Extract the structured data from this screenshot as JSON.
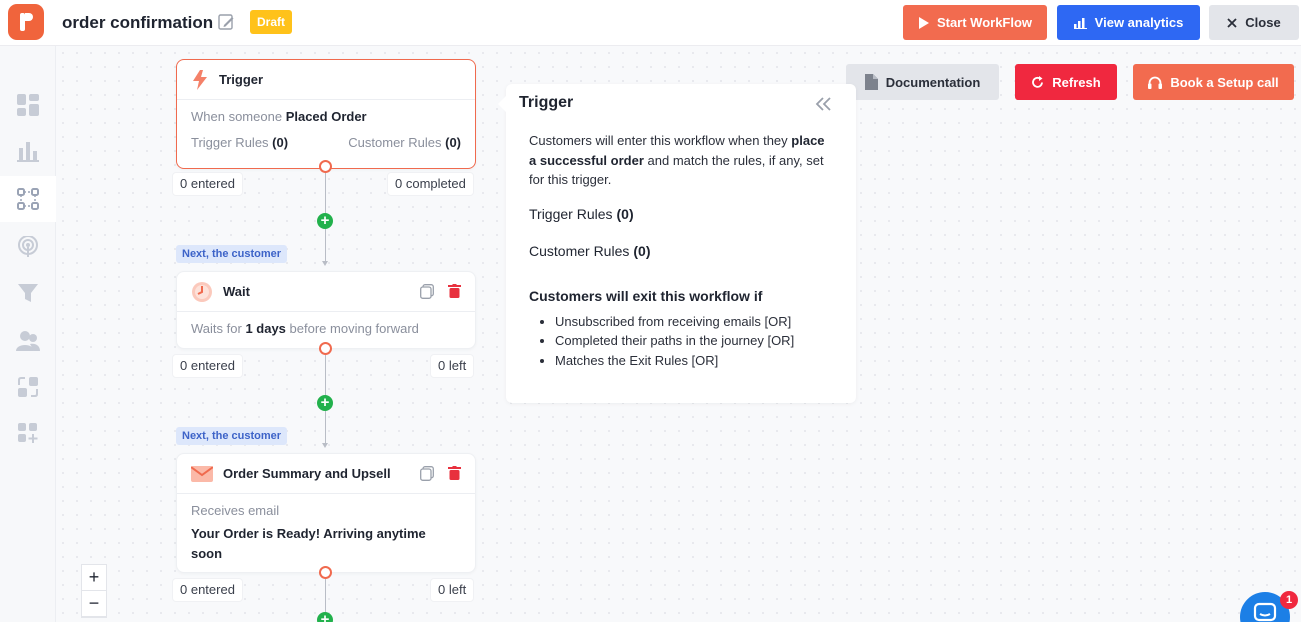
{
  "header": {
    "title": "order confirmation",
    "status_badge": "Draft",
    "start_workflow": "Start WorkFlow",
    "view_analytics": "View analytics",
    "close": "Close"
  },
  "actions": {
    "documentation": "Documentation",
    "refresh": "Refresh",
    "book_setup": "Book a Setup call"
  },
  "sidebar": {
    "items": [
      {
        "icon": "dashboard-icon"
      },
      {
        "icon": "bar-chart-icon"
      },
      {
        "icon": "workflow-icon"
      },
      {
        "icon": "broadcast-icon"
      },
      {
        "icon": "funnel-icon"
      },
      {
        "icon": "users-icon"
      },
      {
        "icon": "sync-icon"
      },
      {
        "icon": "add-widget-icon"
      }
    ]
  },
  "flow": {
    "trigger": {
      "title": "Trigger",
      "desc_prefix": "When someone",
      "desc_value": "Placed Order",
      "trigger_rules_label": "Trigger Rules",
      "trigger_rules_count": "(0)",
      "customer_rules_label": "Customer Rules",
      "customer_rules_count": "(0)",
      "entered": "0 entered",
      "completed": "0 completed"
    },
    "next_label_1": "Next, the customer",
    "wait": {
      "title": "Wait",
      "desc_prefix": "Waits for",
      "desc_value": "1 days",
      "desc_suffix": "before moving forward",
      "entered": "0 entered",
      "left": "0 left"
    },
    "next_label_2": "Next, the customer",
    "email": {
      "title": "Order Summary and Upsell",
      "desc_label": "Receives email",
      "subject": "Your Order is Ready! Arriving anytime soon",
      "entered": "0 entered",
      "left": "0 left"
    }
  },
  "panel": {
    "title": "Trigger",
    "desc_part1": "Customers will enter this workflow when they",
    "desc_bold": "place a successful order",
    "desc_part2": "and match the rules, if any, set for this trigger.",
    "trigger_rules_label": "Trigger Rules",
    "trigger_rules_count": "(0)",
    "customer_rules_label": "Customer Rules",
    "customer_rules_count": "(0)",
    "exit_title": "Customers will exit this workflow if",
    "exit_items": [
      "Unsubscribed from receiving emails [OR]",
      "Completed their paths in the journey [OR]",
      "Matches the Exit Rules [OR]"
    ]
  },
  "zoom": {
    "in": "+",
    "out": "−"
  },
  "chat": {
    "badge": "1"
  },
  "colors": {
    "accent": "#f26b4f",
    "primary_blue": "#2e68f3",
    "danger": "#f0283f",
    "draft": "#ffc21a",
    "success": "#22b14c"
  }
}
